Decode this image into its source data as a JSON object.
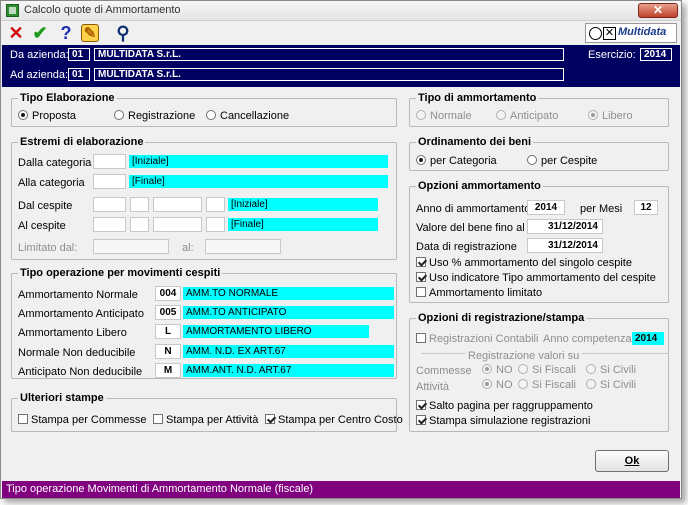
{
  "window": {
    "title": "Calcolo quote di Ammortamento"
  },
  "toolbar": {
    "close_glyph": "✕",
    "confirm_glyph": "✔",
    "help_glyph": "?",
    "edit_glyph": "✎",
    "search_glyph": "⚲",
    "logo_text": "Multidata"
  },
  "header": {
    "da_azienda_label": "Da azienda:",
    "da_azienda_code": "01",
    "da_azienda_name": "MULTIDATA S.r.L.",
    "ad_azienda_label": "Ad azienda:",
    "ad_azienda_code": "01",
    "ad_azienda_name": "MULTIDATA S.r.L.",
    "esercizio_label": "Esercizio:",
    "esercizio_value": "2014"
  },
  "tipo_elaborazione": {
    "title": "Tipo Elaborazione",
    "options": [
      "Proposta",
      "Registrazione",
      "Cancellazione"
    ],
    "selected": "Proposta"
  },
  "estremi": {
    "title": "Estremi di elaborazione",
    "dalla_categoria_label": "Dalla categoria",
    "dalla_categoria_value": "[Iniziale]",
    "alla_categoria_label": "Alla categoria",
    "alla_categoria_value": "[Finale]",
    "dal_cespite_label": "Dal cespite",
    "dal_cespite_value": "[Iniziale]",
    "al_cespite_label": "Al cespite",
    "al_cespite_value": "[Finale]",
    "limitato_dal_label": "Limitato dal:",
    "al_label": "al:"
  },
  "tipo_operazione": {
    "title": "Tipo operazione per movimenti cespiti",
    "rows": [
      {
        "label": "Ammortamento Normale",
        "code": "004",
        "desc": "AMM.TO NORMALE"
      },
      {
        "label": "Ammortamento Anticipato",
        "code": "005",
        "desc": "AMM.TO ANTICIPATO"
      },
      {
        "label": "Ammortamento Libero",
        "code": "L",
        "desc": "AMMORTAMENTO LIBERO"
      },
      {
        "label": "Normale Non deducibile",
        "code": "N",
        "desc": "AMM. N.D. EX ART.67"
      },
      {
        "label": "Anticipato Non deducibile",
        "code": "M",
        "desc": "AMM.ANT. N.D. ART.67"
      }
    ]
  },
  "ulteriori": {
    "title": "Ulteriori stampe",
    "commesse": "Stampa per Commesse",
    "attivita": "Stampa per Attività",
    "centro_costo": "Stampa per Centro Costo"
  },
  "tipo_ammortamento": {
    "title": "Tipo di ammortamento",
    "options": [
      "Normale",
      "Anticipato",
      "Libero"
    ],
    "selected": "Libero"
  },
  "ordinamento": {
    "title": "Ordinamento dei beni",
    "options": [
      "per Categoria",
      "per Cespite"
    ],
    "selected": "per Categoria"
  },
  "opzioni": {
    "title": "Opzioni ammortamento",
    "anno_label": "Anno di ammortamento",
    "anno_value": "2014",
    "mesi_label": "per Mesi",
    "mesi_value": "12",
    "valore_label": "Valore del bene fino al",
    "valore_value": "31/12/2014",
    "data_label": "Data di registrazione",
    "data_value": "31/12/2014",
    "uso_percent": "Uso % ammortamento del singolo cespite",
    "uso_indicatore": "Uso indicatore Tipo ammortamento del cespite",
    "limitato": "Ammortamento limitato"
  },
  "registrazione": {
    "title": "Opzioni di registrazione/stampa",
    "contabili": "Registrazioni Contabili",
    "anno_comp_label": "Anno competenza",
    "anno_comp_value": "2014",
    "reg_valori_label": "Registrazione valori su",
    "commesse_label": "Commesse",
    "attivita_label": "Attività",
    "opt_no": "NO",
    "opt_fiscali": "Si Fiscali",
    "opt_civili": "Si Civili",
    "salto_pagina": "Salto pagina per raggruppamento",
    "stampa_sim": "Stampa simulazione registrazioni"
  },
  "ok_label": "Ok",
  "status": "Tipo operazione Movimenti di Ammortamento Normale (fiscale)"
}
